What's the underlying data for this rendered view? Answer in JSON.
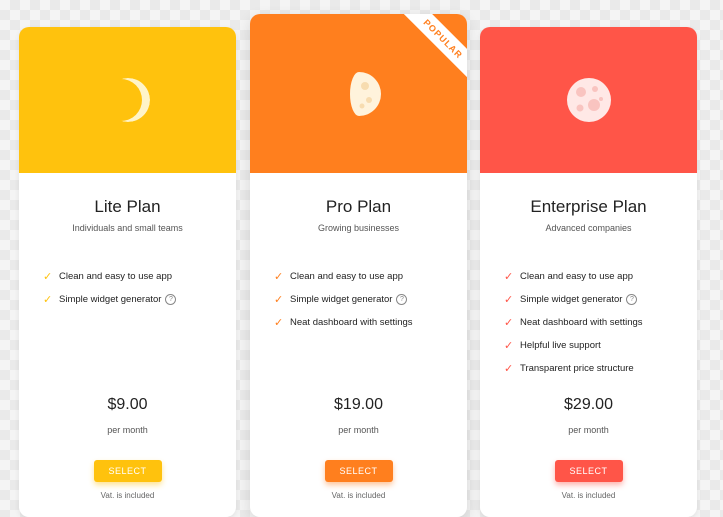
{
  "colors": {
    "lite": "#ffc20d",
    "pro": "#ff7f1e",
    "enterprise": "#ff5548",
    "background": "#f4f4f4"
  },
  "plans": [
    {
      "name": "Lite Plan",
      "subtitle": "Individuals and small teams",
      "icon": "crescent-moon-icon",
      "features": [
        "Clean and easy to use app",
        "Simple widget generator"
      ],
      "price": "$9.00",
      "period": "per month",
      "button": "SELECT",
      "vat": "Vat. is included"
    },
    {
      "name": "Pro Plan",
      "subtitle": "Growing businesses",
      "icon": "half-moon-icon",
      "badge": "POPULAR",
      "features": [
        "Clean and easy to use app",
        "Simple widget generator",
        "Neat dashboard with settings"
      ],
      "price": "$19.00",
      "period": "per month",
      "button": "SELECT",
      "vat": "Vat. is included"
    },
    {
      "name": "Enterprise Plan",
      "subtitle": "Advanced companies",
      "icon": "full-moon-icon",
      "features": [
        "Clean and easy to use app",
        "Simple widget generator",
        "Neat dashboard with settings",
        "Helpful live support",
        "Transparent price structure"
      ],
      "price": "$29.00",
      "period": "per month",
      "button": "SELECT",
      "vat": "Vat. is included"
    }
  ]
}
